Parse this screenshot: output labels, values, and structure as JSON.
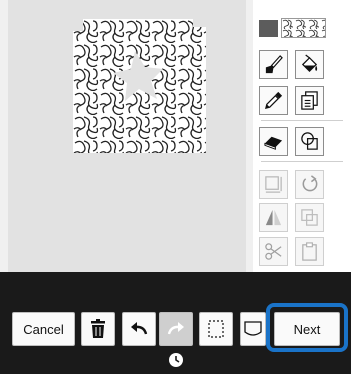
{
  "buttons": {
    "cancel_label": "Cancel",
    "next_label": "Next"
  },
  "icons": {
    "fill_pattern": "quilt-stipple-pattern",
    "swatch": "dark-gray-fill"
  },
  "colors": {
    "accent_highlight": "#1a73c8",
    "canvas_bg": "#e2e2e2",
    "toolbar_bg": "#1a1a1a",
    "swatch_dark": "#5c5c5c"
  }
}
